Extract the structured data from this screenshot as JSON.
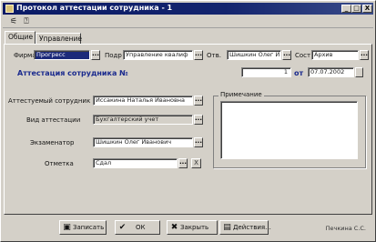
{
  "window": {
    "title": "Протокол аттестации сотрудника - 1",
    "controls": {
      "minimize": "_",
      "maximize": "□",
      "close": "X"
    }
  },
  "toolbar": {
    "icons": [
      {
        "name": "settings-icon",
        "glyph": "⚟"
      },
      {
        "name": "help-pointer-icon",
        "glyph": "⍰"
      }
    ]
  },
  "tabs": [
    {
      "label": "Общие",
      "active": true
    },
    {
      "label": "Управление",
      "active": false
    }
  ],
  "form": {
    "firm": {
      "label": "Фирма",
      "value": "Прогресс"
    },
    "podr": {
      "label": "Подр",
      "value": "Управление квалиф"
    },
    "otv": {
      "label": "Отв.",
      "value": "Шишкин Олег И"
    },
    "sost": {
      "label": "Сост",
      "value": "Архив"
    },
    "heading": "Аттестация сотрудника №",
    "number": "1",
    "ot_label": "от",
    "date": "07.07.2002",
    "employee": {
      "label": "Аттестуемый сотрудник",
      "value": "Иссакина Наталья Ивановна"
    },
    "att_type": {
      "label": "Вид аттестации",
      "value": "Бухгалтерский учет"
    },
    "examiner": {
      "label": "Экзаменатор",
      "value": "Шишкин Олег Иванович"
    },
    "grade": {
      "label": "Отметка",
      "value": "Сдал"
    },
    "note": {
      "label": "Примечание",
      "value": ""
    },
    "dots": "...",
    "clear": "X"
  },
  "bottom": {
    "buttons": [
      {
        "label": "Записать",
        "icon": "save-icon",
        "glyph": "▣"
      },
      {
        "label": "ОК",
        "icon": "ok-check-icon",
        "glyph": "✔"
      },
      {
        "label": "Закрыть",
        "icon": "close-x-icon",
        "glyph": "✖"
      },
      {
        "label": "Действия...",
        "icon": "actions-icon",
        "glyph": "▤"
      }
    ],
    "author": "Печкина С.С."
  }
}
